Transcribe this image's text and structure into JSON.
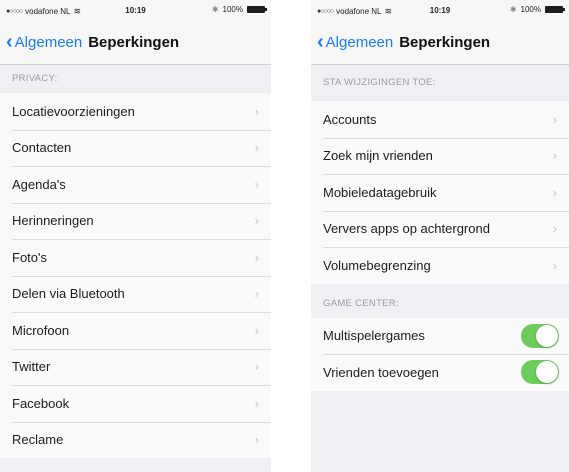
{
  "left": {
    "status": {
      "carrier": "vodafone NL",
      "time": "10:19",
      "battery": "100%"
    },
    "nav": {
      "back_label": "Algemeen",
      "title": "Beperkingen"
    },
    "section": "PRIVACY:",
    "items": [
      {
        "label": "Locatievoorzieningen"
      },
      {
        "label": "Contacten"
      },
      {
        "label": "Agenda's"
      },
      {
        "label": "Herinneringen"
      },
      {
        "label": "Foto's"
      },
      {
        "label": "Delen via Bluetooth"
      },
      {
        "label": "Microfoon"
      },
      {
        "label": "Twitter"
      },
      {
        "label": "Facebook"
      },
      {
        "label": "Reclame"
      }
    ]
  },
  "right": {
    "status": {
      "carrier": "vodafone NL",
      "time": "10:19",
      "battery": "100%"
    },
    "nav": {
      "back_label": "Algemeen",
      "title": "Beperkingen"
    },
    "section_changes": "STA WIJZIGINGEN TOE:",
    "change_items": [
      {
        "label": "Accounts"
      },
      {
        "label": "Zoek mijn vrienden"
      },
      {
        "label": "Mobieledatagebruik"
      },
      {
        "label": "Ververs apps op achtergrond"
      },
      {
        "label": "Volumebegrenzing"
      }
    ],
    "section_game": "GAME CENTER:",
    "game_items": [
      {
        "label": "Multispelergames",
        "on": true
      },
      {
        "label": "Vrienden toevoegen",
        "on": true
      }
    ]
  },
  "colors": {
    "accent": "#1a7cf5",
    "toggle_on": "#6ccc5c",
    "background": "#efeff4"
  }
}
